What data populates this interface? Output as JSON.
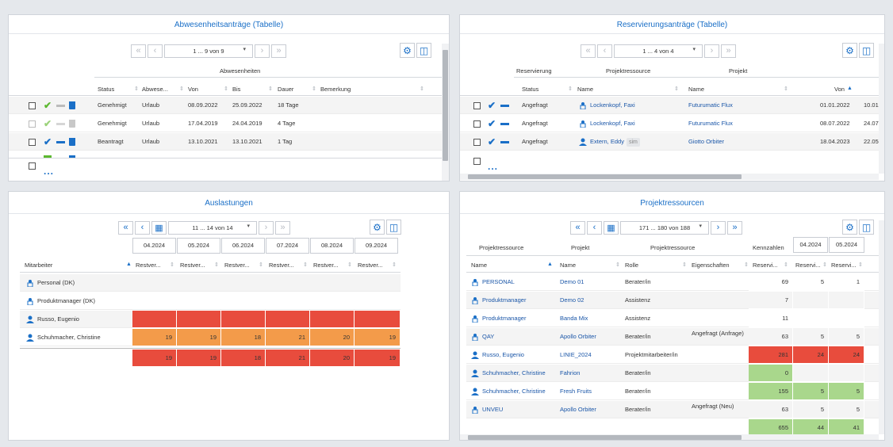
{
  "colors": {
    "accent": "#1a6fc7",
    "red": "#e84c3d",
    "orange": "#f39b4a",
    "green": "#a9d78c"
  },
  "p1": {
    "title": "Abwesenheitsanträge (Tabelle)",
    "pager": "1 ... 9 von 9",
    "group_header": "Abwesenheiten",
    "cols": [
      "Status",
      "Abwese...",
      "Von",
      "Bis",
      "Dauer",
      "Bemerkung"
    ],
    "rows": [
      {
        "status": "Genehmigt",
        "type": "Urlaub",
        "von": "08.09.2022",
        "bis": "25.09.2022",
        "dauer": "18 Tage"
      },
      {
        "status": "Genehmigt",
        "type": "Urlaub",
        "von": "17.04.2019",
        "bis": "24.04.2019",
        "dauer": "4 Tage"
      },
      {
        "status": "Beantragt",
        "type": "Urlaub",
        "von": "13.10.2021",
        "bis": "13.10.2021",
        "dauer": "1 Tag"
      }
    ],
    "more": "..."
  },
  "p2": {
    "title": "Reservierungsanträge (Tabelle)",
    "pager": "1 ... 4 von 4",
    "groups": [
      "Reservierung",
      "Projektressource",
      "Projekt"
    ],
    "cols": [
      "Status",
      "Name",
      "Name",
      "Von"
    ],
    "rows": [
      {
        "status": "Angefragt",
        "res": "Lockenkopf, Faxi",
        "proj": "Futurumatic Flux",
        "von": "01.01.2022",
        "bis": "10.01"
      },
      {
        "status": "Angefragt",
        "res": "Lockenkopf, Faxi",
        "proj": "Futurumatic Flux",
        "von": "08.07.2022",
        "bis": "24.07"
      },
      {
        "status": "Angefragt",
        "res": "Extern, Eddy",
        "badge": "sim",
        "proj": "Giotto Orbiter",
        "von": "18.04.2023",
        "bis": "22.05"
      }
    ],
    "more": "..."
  },
  "p3": {
    "title": "Auslastungen",
    "pager": "11 ... 14 von 14",
    "dates": [
      "04.2024",
      "05.2024",
      "06.2024",
      "07.2024",
      "08.2024",
      "09.2024"
    ],
    "col_first": "Mitarbeiter",
    "col_rest": "Restver...",
    "rows": [
      {
        "name": "Personal (DK)"
      },
      {
        "name": "Produktmanager (DK)"
      },
      {
        "name": "Russo, Eugenio"
      },
      {
        "name": "Schuhmacher, Christine",
        "values": [
          "19",
          "19",
          "18",
          "21",
          "20",
          "19"
        ]
      }
    ],
    "totals": [
      "19",
      "19",
      "18",
      "21",
      "20",
      "19"
    ]
  },
  "p4": {
    "title": "Projektressourcen",
    "pager": "171 ... 180 von 188",
    "groups": [
      "Projektressource",
      "Projekt",
      "Projektressource",
      "Kennzahlen"
    ],
    "dates": [
      "04.2024",
      "05.2024"
    ],
    "cols": [
      "Name",
      "Name",
      "Rolle",
      "Eigenschaften",
      "Reservi...",
      "Reservi...",
      "Reservi..."
    ],
    "rows": [
      {
        "res": "PERSONAL",
        "proj": "Demo 01",
        "rolle": "Berater/in",
        "eig": "",
        "k": "69",
        "a": "5",
        "b": "1"
      },
      {
        "res": "Produktmanager",
        "proj": "Demo 02",
        "rolle": "Assistenz",
        "eig": "",
        "k": "7",
        "a": "",
        "b": ""
      },
      {
        "res": "Produktmanager",
        "proj": "Banda Mix",
        "rolle": "Assistenz",
        "eig": "",
        "k": "11",
        "a": "",
        "b": ""
      },
      {
        "res": "QAY",
        "proj": "Apollo Orbiter",
        "rolle": "Berater/in",
        "eig": "Angefragt (Anfrage)",
        "k": "63",
        "a": "5",
        "b": "5"
      },
      {
        "res": "Russo, Eugenio",
        "proj": "LINIE_2024",
        "rolle": "Projektmitarbeiter/in",
        "eig": "",
        "k": "281",
        "a": "24",
        "b": "24"
      },
      {
        "res": "Schuhmacher, Christine",
        "proj": "Fahrion",
        "rolle": "Berater/in",
        "eig": "",
        "k": "0",
        "a": "",
        "b": ""
      },
      {
        "res": "Schuhmacher, Christine",
        "proj": "Fresh Fruits",
        "rolle": "Berater/in",
        "eig": "",
        "k": "155",
        "a": "5",
        "b": "5"
      },
      {
        "res": "UNVEU",
        "proj": "Apollo Orbiter",
        "rolle": "Berater/in",
        "eig": "Angefragt (Neu)",
        "k": "63",
        "a": "5",
        "b": "5"
      }
    ],
    "totals": [
      "655",
      "44",
      "41"
    ]
  }
}
